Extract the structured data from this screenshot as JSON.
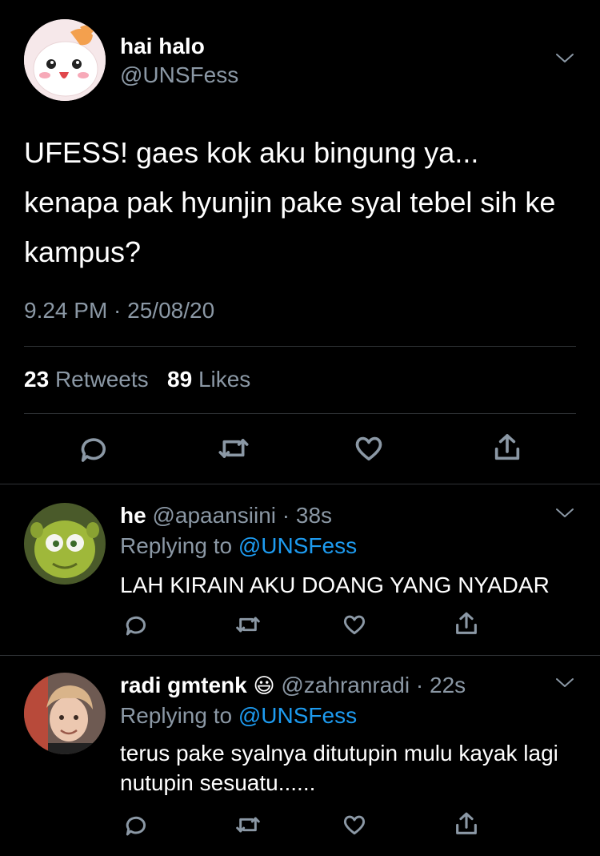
{
  "main_tweet": {
    "display_name": "hai halo",
    "handle": "@UNSFess",
    "text": "UFESS! gaes kok aku bingung ya... kenapa pak hyunjin pake syal tebel sih ke kampus?",
    "timestamp": "9.24 PM · 25/08/20",
    "retweet_count": "23",
    "retweet_label": "Retweets",
    "like_count": "89",
    "like_label": "Likes"
  },
  "replies": [
    {
      "display_name": "he",
      "handle": "@apaansiini",
      "time": "· 38s",
      "replying_prefix": "Replying to",
      "replying_handle": "@UNSFess",
      "text": "LAH KIRAIN AKU DOANG YANG NYADAR"
    },
    {
      "display_name": "radi gmtenk",
      "emoji": "😃",
      "handle": "@zahranradi",
      "time": "· 22s",
      "replying_prefix": "Replying to",
      "replying_handle": "@UNSFess",
      "text": "terus pake syalnya ditutupin mulu kayak lagi nutupin sesuatu......"
    }
  ],
  "icons": [
    "reply-icon",
    "retweet-icon",
    "like-icon",
    "share-icon",
    "chevron-down-icon"
  ],
  "colors": {
    "background": "#000000",
    "secondary_text": "#8b98a5",
    "link": "#1d9bf0"
  }
}
